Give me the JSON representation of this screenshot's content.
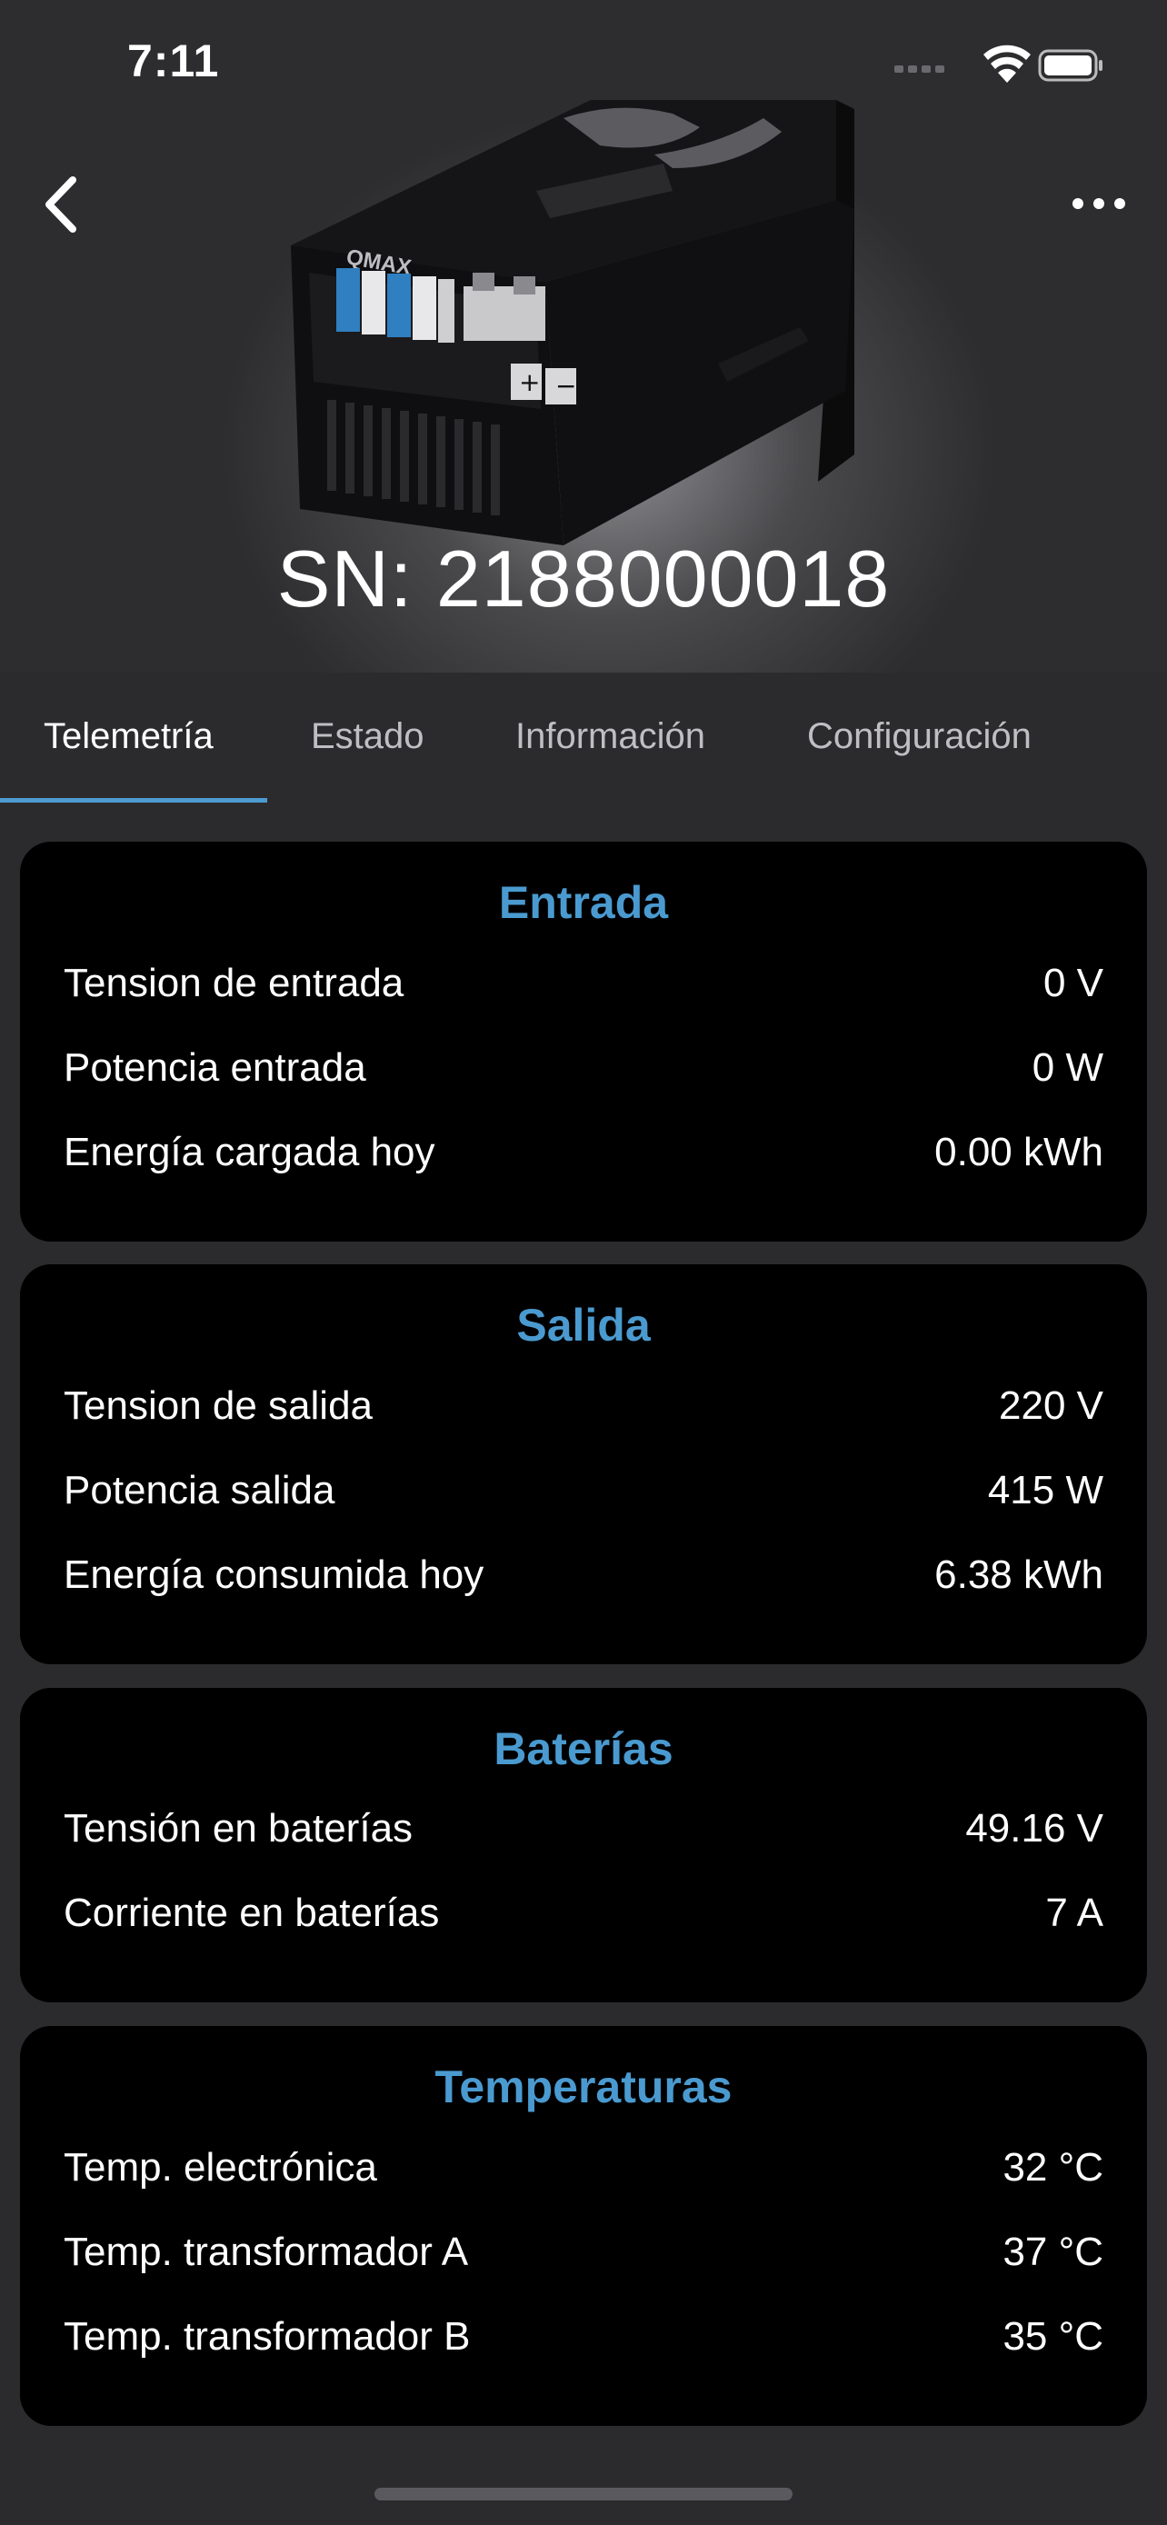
{
  "status_bar": {
    "time": "7:11"
  },
  "header": {
    "serial": "SN: 2188000018",
    "device_brand": "QMAX"
  },
  "tabs": [
    {
      "label": "Telemetría",
      "active": true
    },
    {
      "label": "Estado",
      "active": false
    },
    {
      "label": "Información",
      "active": false
    },
    {
      "label": "Configuración",
      "active": false
    }
  ],
  "sections": {
    "entrada": {
      "title": "Entrada",
      "rows": [
        {
          "label": "Tension de entrada",
          "value": "0 V"
        },
        {
          "label": "Potencia entrada",
          "value": "0 W"
        },
        {
          "label": "Energía cargada hoy",
          "value": "0.00 kWh"
        }
      ]
    },
    "salida": {
      "title": "Salida",
      "rows": [
        {
          "label": "Tension de salida",
          "value": "220 V"
        },
        {
          "label": "Potencia salida",
          "value": "415 W"
        },
        {
          "label": "Energía consumida hoy",
          "value": "6.38 kWh"
        }
      ]
    },
    "baterias": {
      "title": "Baterías",
      "rows": [
        {
          "label": "Tensión en baterías",
          "value": "49.16 V"
        },
        {
          "label": "Corriente en baterías",
          "value": "7 A"
        }
      ]
    },
    "temperaturas": {
      "title": "Temperaturas",
      "rows": [
        {
          "label": "Temp. electrónica",
          "value": "32 °C"
        },
        {
          "label": "Temp. transformador A",
          "value": "37 °C"
        },
        {
          "label": "Temp. transformador B",
          "value": "35 °C"
        }
      ]
    }
  },
  "colors": {
    "accent": "#4a9ad0",
    "card_bg": "#000000",
    "page_bg": "#2b2b2d"
  },
  "icons": [
    "signal-icon",
    "wifi-icon",
    "battery-icon",
    "back-chevron-icon",
    "more-dots-icon"
  ]
}
